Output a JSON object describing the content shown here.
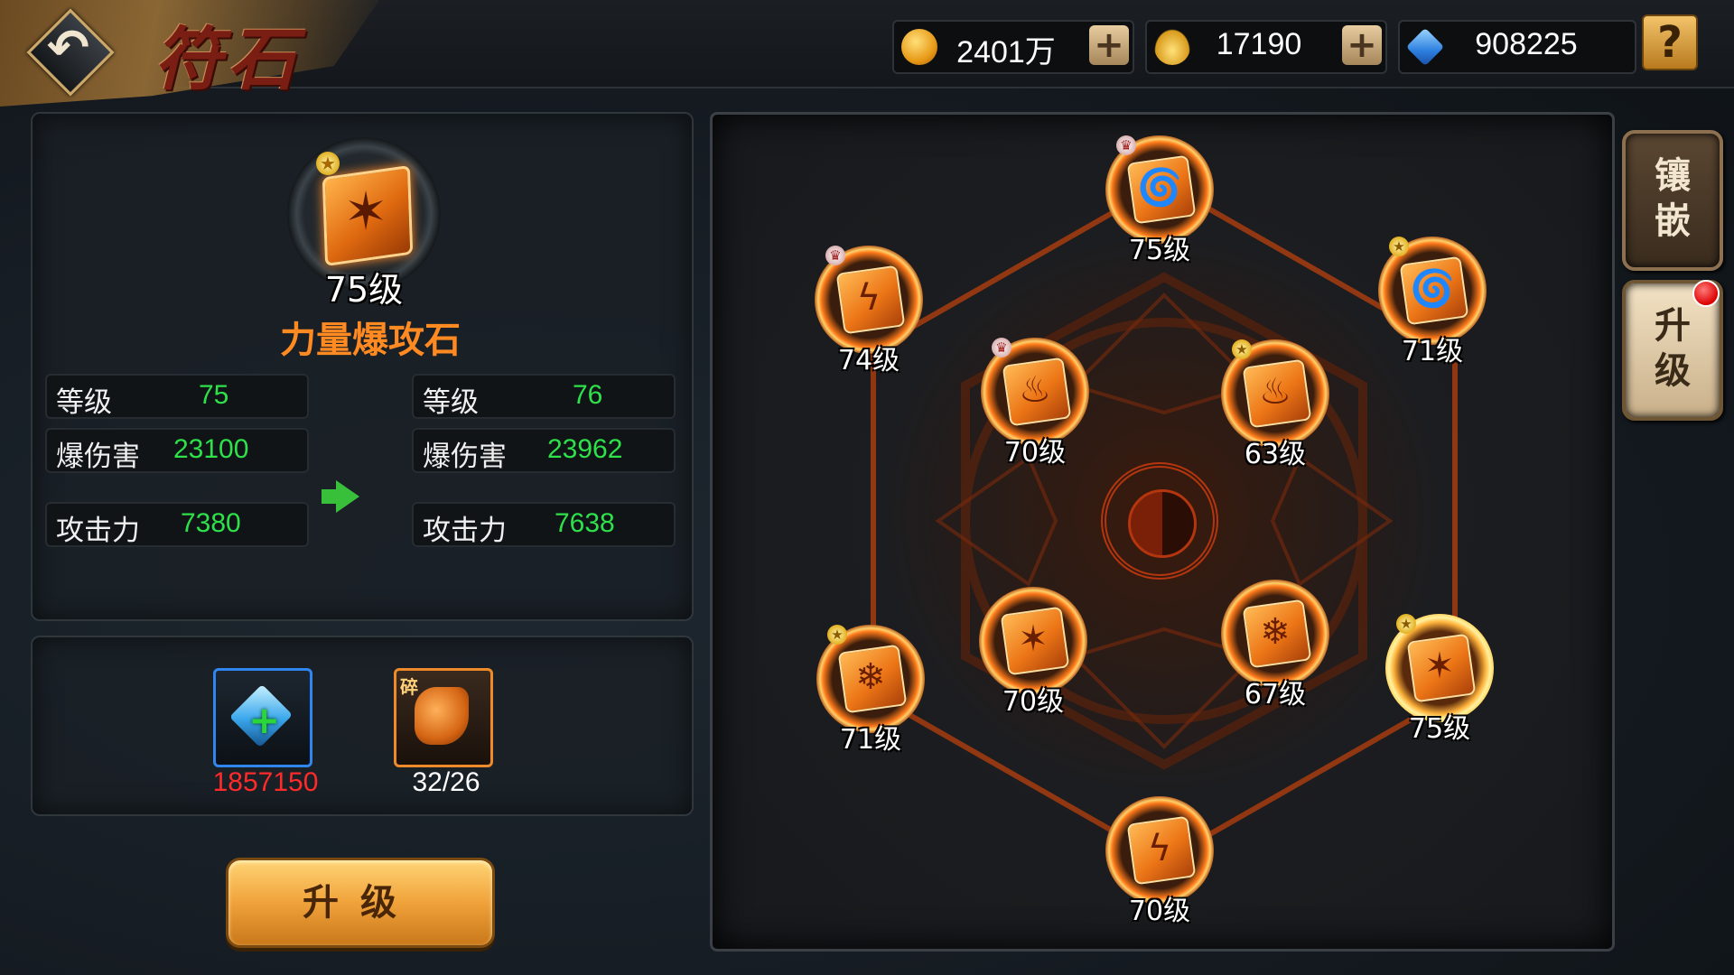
{
  "header": {
    "back_icon": "back-arrow-icon",
    "title": "符石"
  },
  "resources": [
    {
      "icon": "gold-coin-icon",
      "value": "2401万",
      "has_plus": true
    },
    {
      "icon": "gold-ingot-icon",
      "value": "17190",
      "has_plus": true
    },
    {
      "icon": "blue-diamond-icon",
      "value": "908225",
      "has_plus": false
    }
  ],
  "help_label": "?",
  "selected_stone": {
    "level_text": "75级",
    "name": "力量爆攻石",
    "symbol": "claw"
  },
  "current_stats": [
    {
      "label": "等级",
      "value": "75"
    },
    {
      "label": "爆伤害",
      "value": "23100"
    },
    {
      "label": "攻击力",
      "value": "7380"
    }
  ],
  "next_stats": [
    {
      "label": "等级",
      "value": "76"
    },
    {
      "label": "爆伤害",
      "value": "23962"
    },
    {
      "label": "攻击力",
      "value": "7638"
    }
  ],
  "materials": [
    {
      "icon": "blue-gem-plus-icon",
      "count": "1857150",
      "count_color": "#ff2a2a"
    },
    {
      "icon": "stone-fragment-icon",
      "tag": "碎",
      "count": "32/26",
      "count_color": "#ffffff"
    }
  ],
  "upgrade_button": "升级",
  "board_nodes": [
    {
      "level": "75级",
      "symbol": "tornado",
      "badge": "crown",
      "glow": false
    },
    {
      "level": "74级",
      "symbol": "lightning",
      "badge": "crown",
      "glow": false
    },
    {
      "level": "71级",
      "symbol": "tornado",
      "badge": "star",
      "glow": false
    },
    {
      "level": "70级",
      "symbol": "flame",
      "badge": "crown",
      "glow": false
    },
    {
      "level": "63级",
      "symbol": "flame",
      "badge": "star",
      "glow": false
    },
    {
      "level": "71级",
      "symbol": "snowflake",
      "badge": "star",
      "glow": false
    },
    {
      "level": "70级",
      "symbol": "claw",
      "badge": "none",
      "glow": false
    },
    {
      "level": "67级",
      "symbol": "snowflake",
      "badge": "none",
      "glow": false
    },
    {
      "level": "75级",
      "symbol": "claw",
      "badge": "star",
      "glow": true
    },
    {
      "level": "70级",
      "symbol": "lightning",
      "badge": "none",
      "glow": false
    }
  ],
  "side_tabs": [
    {
      "label": "镶嵌",
      "active": false
    },
    {
      "label": "升级",
      "active": true,
      "notification": true
    }
  ],
  "colors": {
    "stat_value": "#2ee14a",
    "stone_name": "#ff8a22",
    "accent_gold": "#f0a23a"
  }
}
